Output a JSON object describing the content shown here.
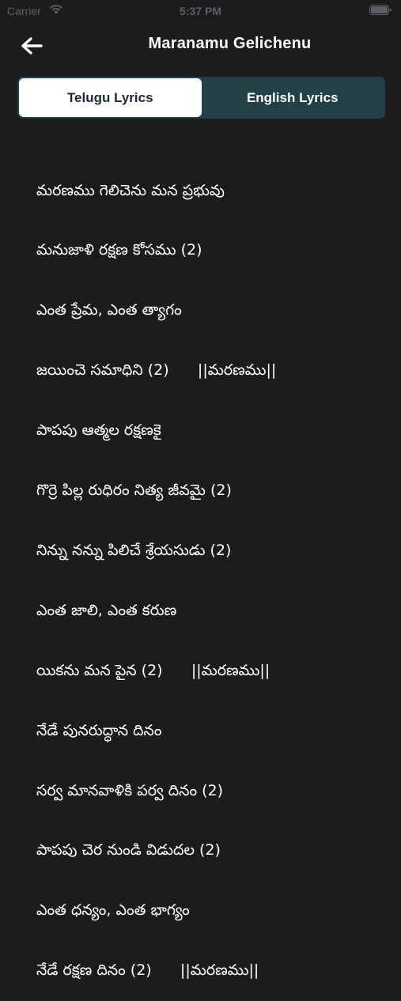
{
  "status_bar": {
    "carrier": "Carrier",
    "time": "5:37 PM",
    "icons": [
      "wifi-icon",
      "battery-icon"
    ]
  },
  "nav": {
    "back_icon": "arrow-left-icon",
    "title": "Maranamu Gelichenu"
  },
  "tabs": [
    {
      "label": "Telugu Lyrics",
      "active": true
    },
    {
      "label": "English Lyrics",
      "active": false
    }
  ],
  "lyrics": [
    "మరణము గెలిచెను మన ప్రభువు",
    "మనుజాళి రక్షణ కోసము (2)",
    "ఎంత ప్రేమ, ఎంత త్యాగం",
    "జయించె సమాధిని (2)      ||మరణము||",
    "పాపపు ఆత్మల రక్షణకై",
    "గొర్రె పిల్ల రుధిరం నిత్య జీవమై (2)",
    "నిన్ను నన్ను పిలిచే శ్రేయసుడు (2)",
    "ఎంత జాలి, ఎంత కరుణ",
    "యికను మన పైన (2)      ||మరణము||",
    "నేడే పునరుద్ధాన దినం",
    "సర్వ మానవాళికి పర్వ దినం (2)",
    "పాపపు చెర నుండి విడుదల (2)",
    "ఎంత ధన్యం, ఎంత భాగ్యం",
    "నేడే రక్షణ దినం (2)      ||మరణము||"
  ],
  "colors": {
    "background": "#1b1c1e",
    "segment_bg": "#234047",
    "active_tab_bg": "#ffffff",
    "active_tab_text": "#1f2a2f",
    "status_text": "#5d5f62"
  }
}
